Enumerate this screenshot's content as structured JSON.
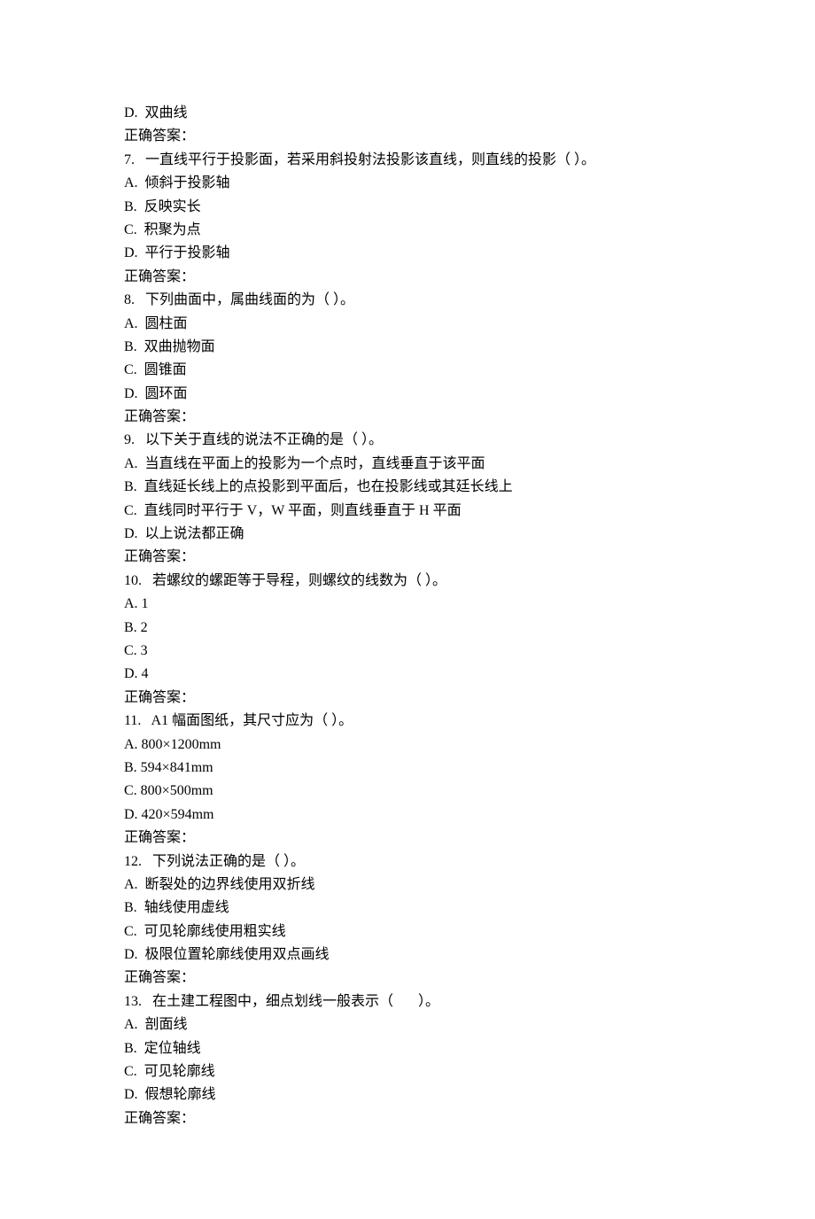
{
  "lines": [
    "D.  双曲线",
    "正确答案：",
    "7.   一直线平行于投影面，若采用斜投射法投影该直线，则直线的投影（ ）。",
    "A.  倾斜于投影轴",
    "B.  反映实长",
    "C.  积聚为点",
    "D.  平行于投影轴",
    "正确答案：",
    "8.   下列曲面中，属曲线面的为（ ）。",
    "A.  圆柱面",
    "B.  双曲抛物面",
    "C.  圆锥面",
    "D.  圆环面",
    "正确答案：",
    "9.   以下关于直线的说法不正确的是（ ）。",
    "A.  当直线在平面上的投影为一个点时，直线垂直于该平面",
    "B.  直线延长线上的点投影到平面后，也在投影线或其廷长线上",
    "C.  直线同时平行于 V，W 平面，则直线垂直于 H 平面",
    "D.  以上说法都正确",
    "正确答案：",
    "10.   若螺纹的螺距等于导程，则螺纹的线数为（ ）。",
    "A. 1",
    "B. 2",
    "C. 3",
    "D. 4",
    "正确答案：",
    "11.   A1 幅面图纸，其尺寸应为（ ）。",
    "A. 800×1200mm",
    "B. 594×841mm",
    "C. 800×500mm",
    "D. 420×594mm",
    "正确答案：",
    "12.   下列说法正确的是（ ）。",
    "A.  断裂处的边界线使用双折线",
    "B.  轴线使用虚线",
    "C.  可见轮廓线使用粗实线",
    "D.  极限位置轮廓线使用双点画线",
    "正确答案：",
    "13.   在土建工程图中，细点划线一般表示（       ）。",
    "A.  剖面线",
    "B.  定位轴线",
    "C.  可见轮廓线",
    "D.  假想轮廓线",
    "正确答案："
  ]
}
